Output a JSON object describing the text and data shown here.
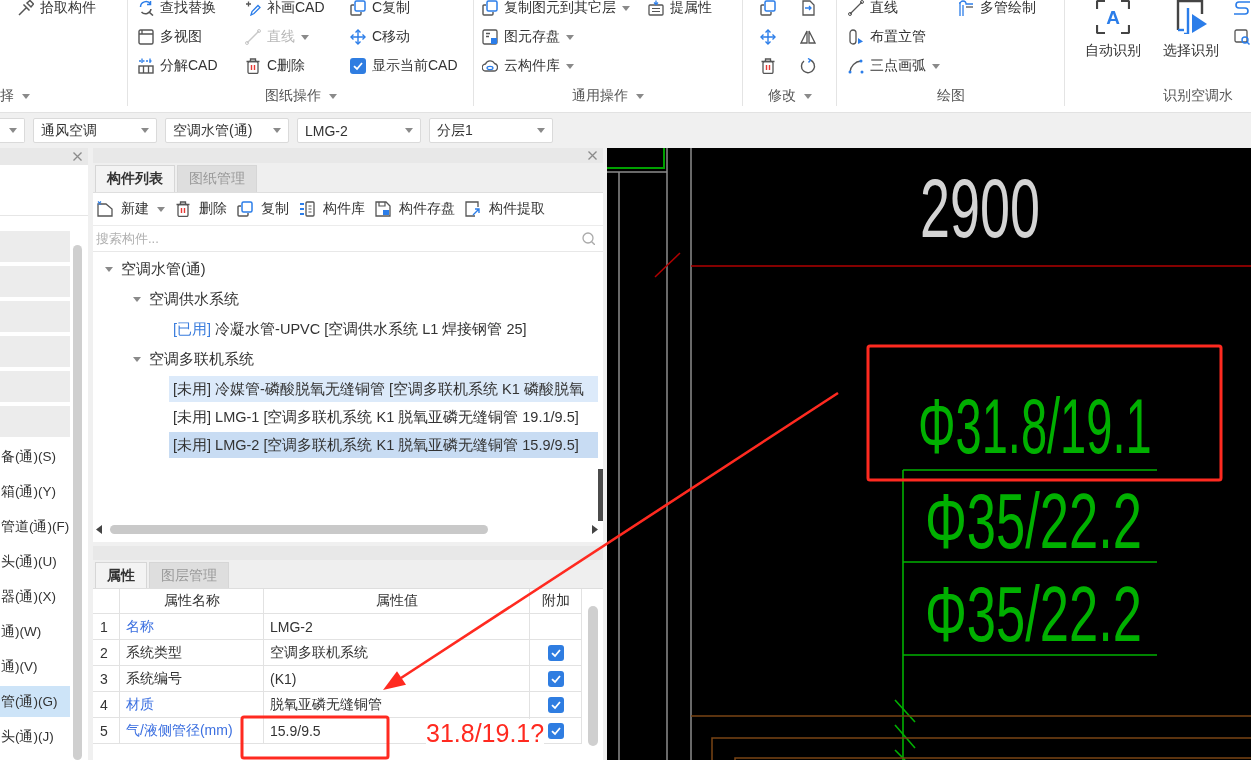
{
  "ribbon": {
    "groups": [
      {
        "label": "择",
        "dropdown": true,
        "columns": [
          [
            {
              "kind": "button",
              "label": "拾取构件",
              "dropdown": false,
              "disabled": false
            }
          ]
        ]
      },
      {
        "label": "图纸操作",
        "dropdown": true,
        "columns": [
          [
            {
              "kind": "button",
              "label": "查找替换",
              "dropdown": false,
              "disabled": false
            },
            {
              "kind": "button",
              "label": "多视图",
              "dropdown": false,
              "disabled": false
            },
            {
              "kind": "button",
              "label": "分解CAD",
              "dropdown": false,
              "disabled": false
            }
          ],
          [
            {
              "kind": "button",
              "label": "补画CAD",
              "dropdown": false,
              "disabled": false
            },
            {
              "kind": "button",
              "label": "直线",
              "dropdown": true,
              "disabled": true
            },
            {
              "kind": "button",
              "label": "C删除",
              "dropdown": false,
              "disabled": false
            }
          ],
          [
            {
              "kind": "button",
              "label": "C复制",
              "dropdown": false,
              "disabled": false
            },
            {
              "kind": "button",
              "label": "C移动",
              "dropdown": false,
              "disabled": false
            },
            {
              "kind": "checkbox",
              "label": "显示当前CAD",
              "checked": true
            }
          ]
        ]
      },
      {
        "label": "通用操作",
        "dropdown": true,
        "columns": [
          [
            {
              "kind": "button",
              "label": "复制图元到其它层",
              "dropdown": true,
              "disabled": false
            },
            {
              "kind": "button",
              "label": "图元存盘",
              "dropdown": true,
              "disabled": false
            },
            {
              "kind": "button",
              "label": "云构件库",
              "dropdown": true,
              "disabled": false
            }
          ],
          [
            {
              "kind": "button",
              "label": "提属性",
              "dropdown": false,
              "disabled": false
            }
          ]
        ]
      },
      {
        "label": "修改",
        "dropdown": true,
        "columns": [
          [
            {
              "kind": "icon"
            },
            {
              "kind": "icon"
            },
            {
              "kind": "icon"
            }
          ],
          [
            {
              "kind": "icon"
            },
            {
              "kind": "icon"
            },
            {
              "kind": "icon"
            }
          ]
        ]
      },
      {
        "label": "绘图",
        "dropdown": false,
        "columns": [
          [
            {
              "kind": "button",
              "label": "直线",
              "dropdown": false,
              "disabled": false
            },
            {
              "kind": "button",
              "label": "布置立管",
              "dropdown": false,
              "disabled": false
            },
            {
              "kind": "button",
              "label": "三点画弧",
              "dropdown": true,
              "disabled": false
            }
          ],
          [
            {
              "kind": "button",
              "label": "多管绘制",
              "dropdown": false,
              "disabled": false
            }
          ]
        ]
      },
      {
        "label": "识别空调水",
        "dropdown": false,
        "columns": [
          [
            {
              "kind": "large",
              "label": "自动识别",
              "icon_text": "A"
            }
          ],
          [
            {
              "kind": "large",
              "label": "选择识别"
            }
          ],
          [
            {
              "kind": "icon"
            },
            {
              "kind": "icon"
            }
          ]
        ]
      }
    ]
  },
  "selector_bar": {
    "selectors": [
      {
        "kind": "clipped"
      },
      {
        "kind": "field",
        "value": "通风空调"
      },
      {
        "kind": "field",
        "value": "空调水管(通)"
      },
      {
        "kind": "field",
        "value": "LMG-2"
      },
      {
        "kind": "field",
        "value": "分层1"
      }
    ]
  },
  "left_panel": {
    "items": [
      {
        "kind": "header"
      },
      {
        "kind": "header"
      },
      {
        "kind": "header"
      },
      {
        "kind": "header"
      },
      {
        "kind": "header"
      },
      {
        "kind": "header"
      },
      {
        "kind": "item",
        "label": "备(通)(S)",
        "selected": false
      },
      {
        "kind": "item",
        "label": "箱(通)(Y)",
        "selected": false
      },
      {
        "kind": "item",
        "label": "管道(通)(F)",
        "selected": false
      },
      {
        "kind": "item",
        "label": "头(通)(U)",
        "selected": false
      },
      {
        "kind": "item",
        "label": "器(通)(X)",
        "selected": false
      },
      {
        "kind": "item",
        "label": "通)(W)",
        "selected": false
      },
      {
        "kind": "item",
        "label": "通)(V)",
        "selected": false
      },
      {
        "kind": "item",
        "label": "管(通)(G)",
        "selected": true
      },
      {
        "kind": "item",
        "label": "头(通)(J)",
        "selected": false
      }
    ]
  },
  "component_panel": {
    "tabs": [
      {
        "label": "构件列表",
        "selected": true
      },
      {
        "label": "图纸管理",
        "selected": false
      }
    ],
    "toolbar": [
      {
        "label": "新建",
        "dropdown": true
      },
      {
        "label": "删除",
        "dropdown": false
      },
      {
        "label": "复制",
        "dropdown": false
      },
      {
        "label": "构件库",
        "dropdown": false
      },
      {
        "label": "构件存盘",
        "dropdown": false
      },
      {
        "label": "构件提取",
        "dropdown": false
      }
    ],
    "search": {
      "placeholder": "搜索构件..."
    },
    "tree": [
      {
        "kind": "group",
        "label": "空调水管(通)",
        "expanded": true,
        "children": [
          {
            "kind": "group",
            "label": "空调供水系统",
            "expanded": true,
            "children": [
              {
                "kind": "component",
                "status": "[已用]",
                "used": true,
                "label": "冷凝水管-UPVC [空调供水系统 L1 焊接钢管 25]",
                "selected": false,
                "highlighted": false
              }
            ]
          },
          {
            "kind": "group",
            "label": "空调多联机系统",
            "expanded": true,
            "children": [
              {
                "kind": "component",
                "status": "[未用]",
                "used": false,
                "label": "冷媒管-磷酸脱氧无缝铜管 [空调多联机系统 K1 磷酸脱氧",
                "selected": false,
                "highlighted": true
              },
              {
                "kind": "component",
                "status": "[未用]",
                "used": false,
                "label": "LMG-1 [空调多联机系统 K1 脱氧亚磷无缝铜管 19.1/9.5]",
                "selected": false,
                "highlighted": false
              },
              {
                "kind": "component",
                "status": "[未用]",
                "used": false,
                "label": "LMG-2 [空调多联机系统 K1 脱氧亚磷无缝铜管 15.9/9.5]",
                "selected": true,
                "highlighted": false
              }
            ]
          }
        ]
      }
    ]
  },
  "properties_panel": {
    "tabs": [
      {
        "label": "属性",
        "selected": true
      },
      {
        "label": "图层管理",
        "selected": false
      }
    ],
    "table": {
      "columns": [
        "属性名称",
        "属性值",
        "附加"
      ],
      "rows": [
        {
          "number": "1",
          "name": "名称",
          "public": true,
          "value": "LMG-2"
        },
        {
          "number": "2",
          "name": "系统类型",
          "public": false,
          "value": "空调多联机系统",
          "checked": true
        },
        {
          "number": "3",
          "name": "系统编号",
          "public": false,
          "value": "(K1)",
          "checked": true
        },
        {
          "number": "4",
          "name": "材质",
          "public": true,
          "value": "脱氧亚磷无缝铜管",
          "checked": true
        },
        {
          "number": "5",
          "name": "气/液侧管径(mm)",
          "public": true,
          "value": "15.9/9.5",
          "checked": true
        }
      ]
    }
  },
  "drawing": {
    "dimension": "2900",
    "pipe_labels": [
      "Φ31.8/19.1",
      "Φ35/22.2",
      "Φ35/22.2"
    ]
  },
  "annotation": {
    "note": "31.8/19.1?"
  }
}
